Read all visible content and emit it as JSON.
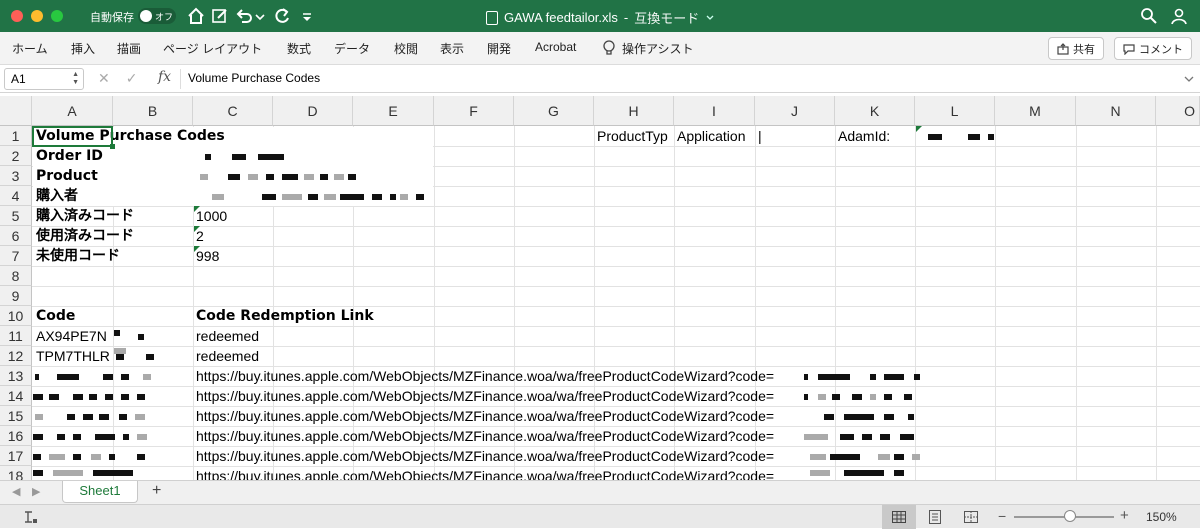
{
  "titlebar": {
    "autosave_label": "自動保存",
    "autosave_state": "オフ",
    "file_title": "GAWA feedtailor.xls",
    "separator": "-",
    "mode": "互換モード"
  },
  "ribbon": {
    "tabs": [
      "ホーム",
      "挿入",
      "描画",
      "ページ レイアウト",
      "数式",
      "データ",
      "校閲",
      "表示",
      "開発",
      "Acrobat"
    ],
    "tell_me": "操作アシスト",
    "share_label": "共有",
    "comment_label": "コメント"
  },
  "formula_bar": {
    "name_box": "A1",
    "fx_label": "fx",
    "content": "Volume Purchase Codes"
  },
  "grid": {
    "columns": [
      "A",
      "B",
      "C",
      "D",
      "E",
      "F",
      "G",
      "H",
      "I",
      "J",
      "K",
      "L",
      "M",
      "N",
      "O"
    ],
    "rows": [
      "1",
      "2",
      "3",
      "4",
      "5",
      "6",
      "7",
      "8",
      "9",
      "10",
      "11",
      "12",
      "13",
      "14",
      "15",
      "16",
      "17",
      "18"
    ],
    "cells": {
      "A1": "Volume Purchase Codes",
      "H1": "ProductTyp",
      "I1": "Application",
      "J1": "|",
      "K1": "AdamId:",
      "A2": "Order ID",
      "A3": "Product",
      "A4": "購入者",
      "A5": "購入済みコード",
      "C5": "1000",
      "A6": "使用済みコード",
      "C6": "2",
      "A7": "未使用コード",
      "C7": "998",
      "A10": "Code",
      "C10": "Code Redemption Link",
      "A11": "AX94PE7N",
      "C11": "redeemed",
      "A12": "TPM7THLR",
      "C12": "redeemed",
      "C13": "https://buy.itunes.apple.com/WebObjects/MZFinance.woa/wa/freeProductCodeWizard?code=",
      "C14": "https://buy.itunes.apple.com/WebObjects/MZFinance.woa/wa/freeProductCodeWizard?code=",
      "C15": "https://buy.itunes.apple.com/WebObjects/MZFinance.woa/wa/freeProductCodeWizard?code=",
      "C16": "https://buy.itunes.apple.com/WebObjects/MZFinance.woa/wa/freeProductCodeWizard?code=",
      "C17": "https://buy.itunes.apple.com/WebObjects/MZFinance.woa/wa/freeProductCodeWizard?code=",
      "C18": "https://buy.itunes.apple.com/WebObjects/MZFinance.woa/wa/freeProductCodeWizard?code="
    }
  },
  "sheets": {
    "tabs": [
      "Sheet1"
    ],
    "add_label": "+"
  },
  "status": {
    "zoom": "150%",
    "zoom_fraction": 0.5
  },
  "colors": {
    "accent": "#217346",
    "selection": "#1e7a3a"
  }
}
